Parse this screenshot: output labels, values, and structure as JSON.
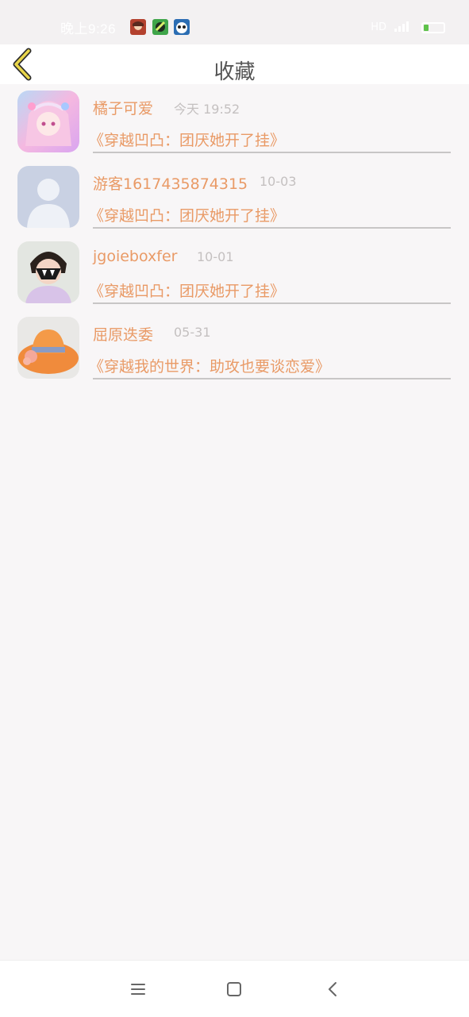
{
  "status_bar": {
    "time": "晚上9:26",
    "battery_level": 0.25,
    "notification_icons": [
      "anime-app-icon",
      "game-app-icon",
      "panda-app-icon"
    ],
    "status_icons": [
      "hd-icon",
      "wifi-signal-icon",
      "battery-icon"
    ]
  },
  "header": {
    "title": "收藏",
    "back_icon": "chevron-left-icon"
  },
  "favorites": [
    {
      "user": "橘子可爱",
      "time": "今天 19:52",
      "novel": "《穿越凹凸：团厌她开了挂》",
      "avatar": "anime-girl-avatar"
    },
    {
      "user": "游客1617435874315",
      "time": "10-03",
      "novel": "《穿越凹凸：团厌她开了挂》",
      "avatar": "default-user-avatar"
    },
    {
      "user": "jgoieboxfer",
      "time": "10-01",
      "novel": "《穿越凹凸：团厌她开了挂》",
      "avatar": "masked-girl-avatar"
    },
    {
      "user": "屈原迭委",
      "time": "05-31",
      "novel": "《穿越我的世界：助攻也要谈恋爱》",
      "avatar": "orange-hat-avatar"
    }
  ],
  "nav_bar": {
    "icons": [
      "menu-icon",
      "home-square-icon",
      "back-chevron-icon"
    ]
  },
  "colors": {
    "accent": "#e99a66",
    "time_text": "#c4c0c0",
    "title_text": "#555555",
    "back_icon": "#e8d54a",
    "background": "#f8f6f7"
  }
}
